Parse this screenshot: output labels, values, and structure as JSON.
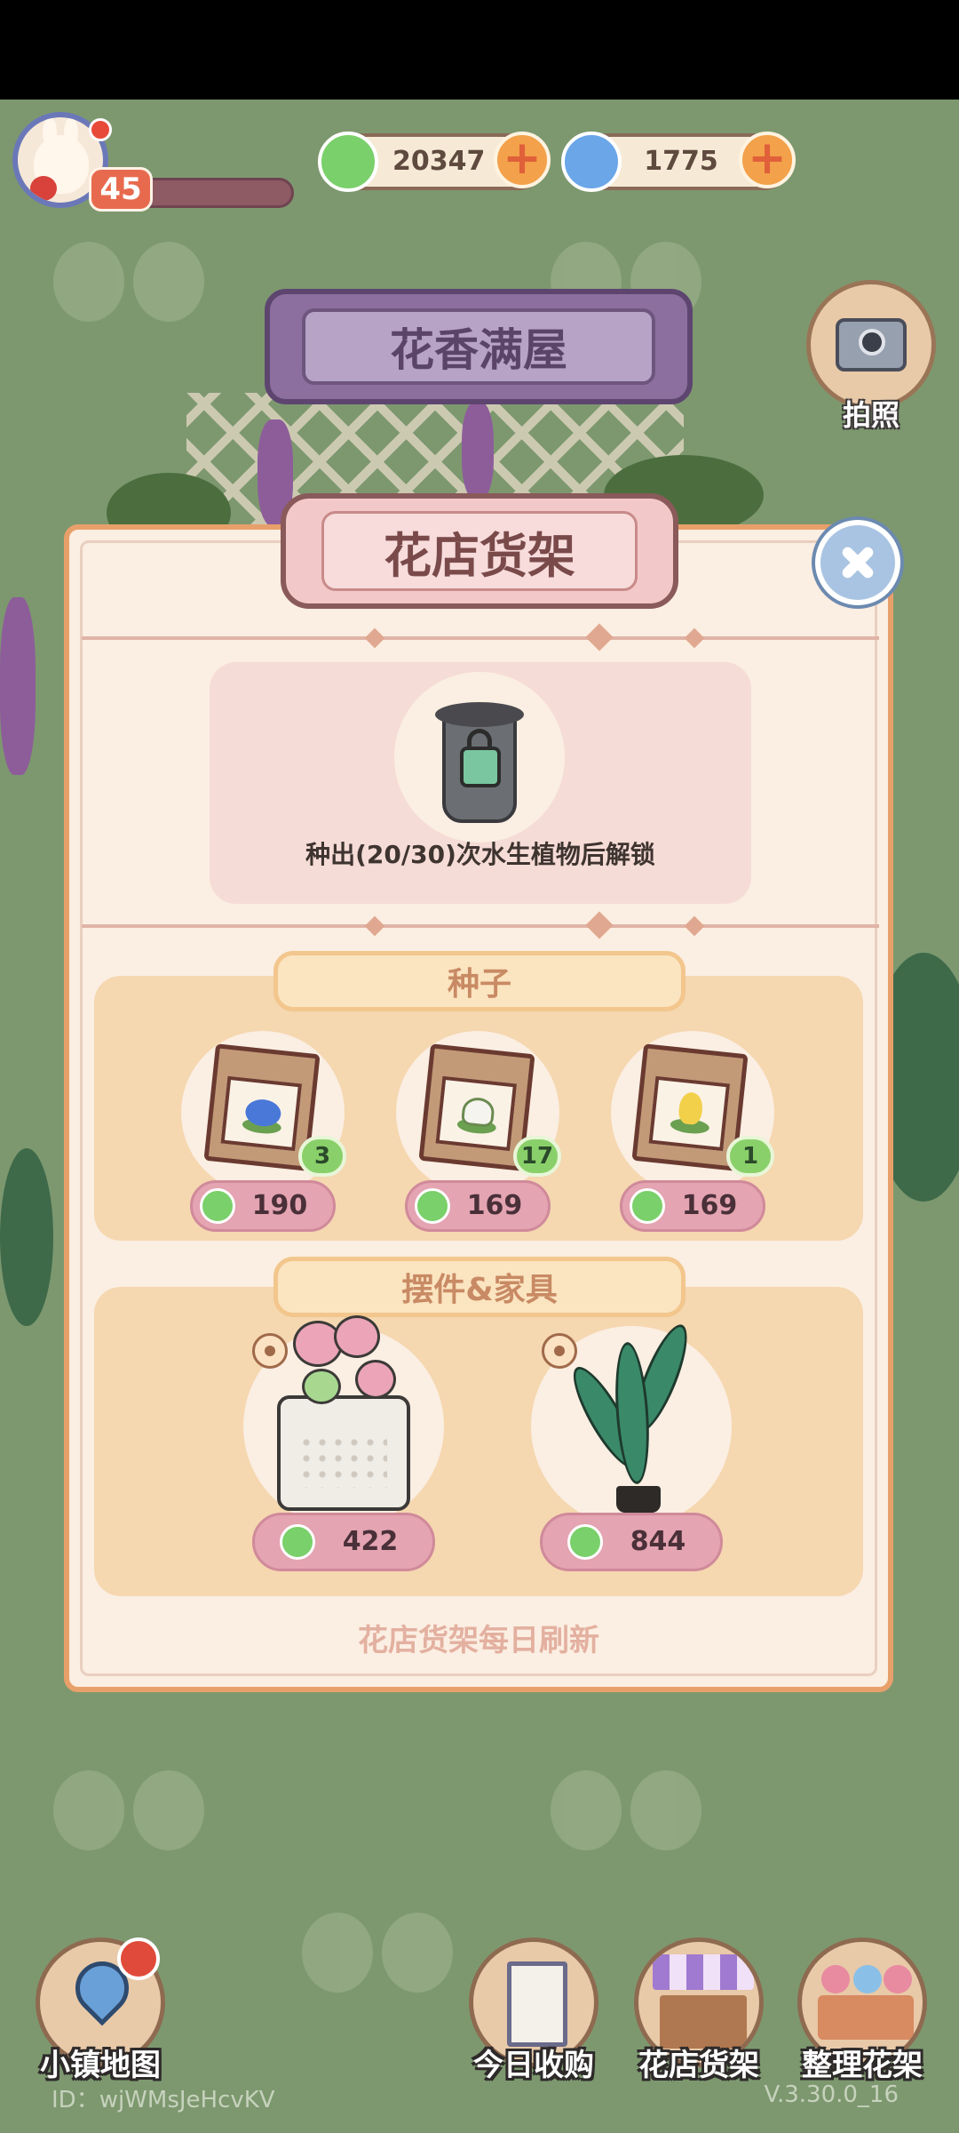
{
  "status_bar": {},
  "player": {
    "level": "45",
    "xp_progress": 0.12
  },
  "currencies": [
    {
      "name": "clover",
      "icon": "clover-icon",
      "value": "20347"
    },
    {
      "name": "swirl",
      "icon": "swirl-icon",
      "value": "1775"
    }
  ],
  "header": {
    "title": "花香满屋",
    "camera_label": "拍照"
  },
  "shop_panel": {
    "title": "花店货架",
    "locked_slot": {
      "icon": "locked-pot-icon",
      "text": "种出(20/30)次水生植物后解锁"
    },
    "seeds_section": {
      "title": "种子",
      "items": [
        {
          "icon": "blue-flower-seed-icon",
          "count": "3",
          "price": "190"
        },
        {
          "icon": "lotus-seed-icon",
          "count": "17",
          "price": "169"
        },
        {
          "icon": "tulip-seed-icon",
          "count": "1",
          "price": "169"
        }
      ]
    },
    "furniture_section": {
      "title": "摆件&家具",
      "items": [
        {
          "icon": "pink-flower-pot-icon",
          "price": "422"
        },
        {
          "icon": "banana-plant-icon",
          "price": "844"
        }
      ]
    },
    "footer_note": "花店货架每日刷新"
  },
  "bottom_nav": [
    {
      "label": "小镇地图",
      "icon": "map-pin-icon"
    },
    {
      "label": "今日收购",
      "icon": "framed-plant-icon"
    },
    {
      "label": "花店货架",
      "icon": "flower-stall-icon"
    },
    {
      "label": "整理花架",
      "icon": "flower-rack-icon"
    }
  ],
  "footer": {
    "id_text": "ID：wjWMsJeHcvKV",
    "version": "V.3.30.0_16"
  },
  "colors": {
    "background": "#7d986f",
    "panel": "#fbeee2",
    "panel_border": "#e8a06a",
    "price_pill": "#e4a4b2",
    "banner": "#8c6f9e"
  }
}
